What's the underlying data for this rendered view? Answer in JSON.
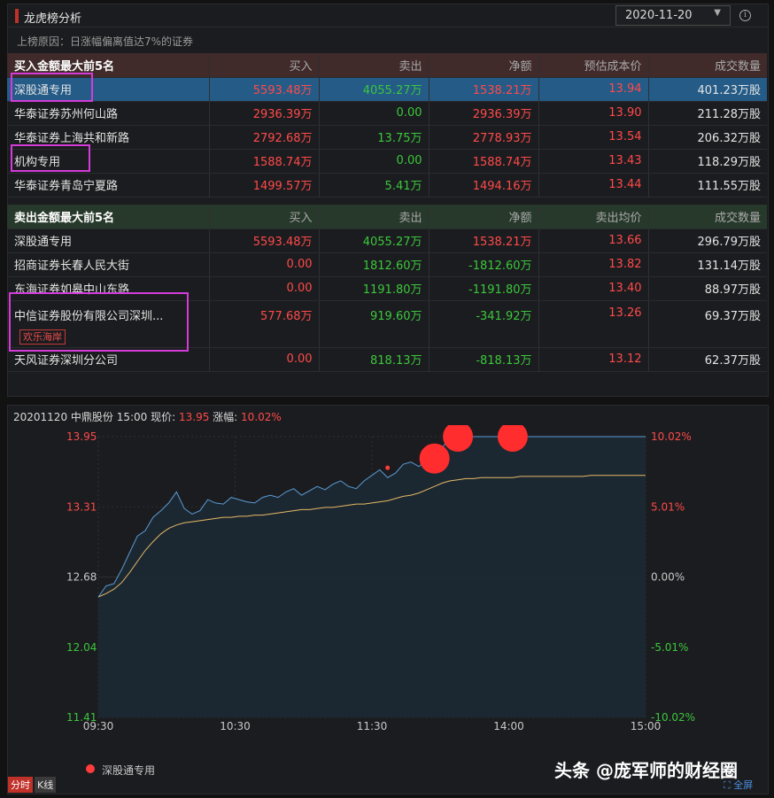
{
  "panel": {
    "title": "龙虎榜分析",
    "date": "2020-11-20",
    "reason": "上榜原因：日涨幅偏离值达7%的证券"
  },
  "buy_table": {
    "headers": [
      "买入金额最大前5名",
      "买入",
      "卖出",
      "净额",
      "预估成本价",
      "成交数量"
    ],
    "rows": [
      {
        "name": "深股通专用",
        "buy": "5593.48万",
        "sell": "4055.27万",
        "net": "1538.21万",
        "price": "13.94",
        "vol": "401.23万股"
      },
      {
        "name": "华泰证券苏州何山路",
        "buy": "2936.39万",
        "sell": "0.00",
        "net": "2936.39万",
        "price": "13.90",
        "vol": "211.28万股"
      },
      {
        "name": "华泰证券上海共和新路",
        "buy": "2792.68万",
        "sell": "13.75万",
        "net": "2778.93万",
        "price": "13.54",
        "vol": "206.32万股"
      },
      {
        "name": "机构专用",
        "buy": "1588.74万",
        "sell": "0.00",
        "net": "1588.74万",
        "price": "13.43",
        "vol": "118.29万股"
      },
      {
        "name": "华泰证券青岛宁夏路",
        "buy": "1499.57万",
        "sell": "5.41万",
        "net": "1494.16万",
        "price": "13.44",
        "vol": "111.55万股"
      }
    ]
  },
  "sell_table": {
    "headers": [
      "卖出金额最大前5名",
      "买入",
      "卖出",
      "净额",
      "卖出均价",
      "成交数量"
    ],
    "rows": [
      {
        "name": "深股通专用",
        "buy": "5593.48万",
        "sell": "4055.27万",
        "net": "1538.21万",
        "price": "13.66",
        "vol": "296.79万股"
      },
      {
        "name": "招商证券长春人民大街",
        "buy": "0.00",
        "sell": "1812.60万",
        "net": "-1812.60万",
        "price": "13.82",
        "vol": "131.14万股"
      },
      {
        "name": "东海证券如皋中山东路",
        "buy": "0.00",
        "sell": "1191.80万",
        "net": "-1191.80万",
        "price": "13.40",
        "vol": "88.97万股"
      },
      {
        "name": "中信证券股份有限公司深圳...",
        "tag": "欢乐海岸",
        "buy": "577.68万",
        "sell": "919.60万",
        "net": "-341.92万",
        "price": "13.26",
        "vol": "69.37万股"
      },
      {
        "name": "天风证券深圳分公司",
        "buy": "0.00",
        "sell": "818.13万",
        "net": "-818.13万",
        "price": "13.12",
        "vol": "62.37万股"
      }
    ]
  },
  "chart_info": {
    "prefix": "20201120 中鼎股份 15:00 现价:",
    "price": "13.95",
    "chg_label": "涨幅:",
    "chg": "10.02%"
  },
  "legend": "深股通专用",
  "watermark": "头条 @庞军师的财经圈",
  "fullscreen": "全屏",
  "tabs": [
    "分时",
    "K线"
  ],
  "colors": {
    "price_line": "#5b9bd5",
    "avg_line": "#e6b866",
    "up": "#ff4a4a",
    "down": "#3cc73c",
    "highlight": "#d43bd9"
  },
  "chart_data": {
    "type": "line",
    "x_ticks": [
      "09:30",
      "10:30",
      "11:30",
      "14:00",
      "15:00"
    ],
    "y_left_ticks": [
      "13.95",
      "13.31",
      "12.68",
      "12.04",
      "11.41"
    ],
    "y_right_ticks": [
      "10.02%",
      "5.01%",
      "0.00%",
      "-5.01%",
      "-10.02%"
    ],
    "ylim": [
      11.41,
      13.95
    ],
    "grid": true,
    "series": [
      {
        "name": "深股通专用",
        "kind": "price",
        "values": [
          12.5,
          12.6,
          12.62,
          12.75,
          12.9,
          13.05,
          13.1,
          13.22,
          13.28,
          13.35,
          13.45,
          13.3,
          13.25,
          13.28,
          13.38,
          13.35,
          13.34,
          13.4,
          13.38,
          13.36,
          13.35,
          13.4,
          13.42,
          13.4,
          13.45,
          13.48,
          13.42,
          13.46,
          13.5,
          13.47,
          13.52,
          13.55,
          13.5,
          13.48,
          13.55,
          13.6,
          13.65,
          13.58,
          13.62,
          13.7,
          13.72,
          13.68,
          13.74,
          13.8,
          13.85,
          13.95,
          13.95,
          13.95,
          13.95,
          13.95,
          13.95,
          13.95,
          13.95,
          13.95,
          13.95,
          13.95,
          13.95,
          13.95,
          13.95,
          13.95,
          13.95,
          13.95,
          13.95,
          13.95,
          13.95,
          13.95,
          13.95,
          13.95,
          13.95,
          13.95,
          13.95
        ]
      },
      {
        "kind": "average",
        "values": [
          12.5,
          12.53,
          12.57,
          12.63,
          12.72,
          12.82,
          12.92,
          13.0,
          13.07,
          13.12,
          13.15,
          13.17,
          13.18,
          13.19,
          13.2,
          13.21,
          13.22,
          13.22,
          13.23,
          13.23,
          13.24,
          13.24,
          13.25,
          13.26,
          13.27,
          13.28,
          13.29,
          13.29,
          13.3,
          13.31,
          13.31,
          13.32,
          13.33,
          13.34,
          13.34,
          13.35,
          13.36,
          13.37,
          13.39,
          13.41,
          13.42,
          13.44,
          13.47,
          13.5,
          13.53,
          13.55,
          13.56,
          13.57,
          13.57,
          13.58,
          13.58,
          13.58,
          13.58,
          13.58,
          13.59,
          13.59,
          13.59,
          13.59,
          13.59,
          13.59,
          13.59,
          13.59,
          13.59,
          13.6,
          13.6,
          13.6,
          13.6,
          13.6,
          13.6,
          13.6,
          13.6
        ]
      }
    ],
    "markers": [
      {
        "type": "trade",
        "x_index": 37,
        "value": 13.62
      },
      {
        "type": "bubble",
        "x_index": 43
      },
      {
        "type": "bubble",
        "x_index": 46
      },
      {
        "type": "bubble",
        "x_index": 53
      }
    ]
  }
}
